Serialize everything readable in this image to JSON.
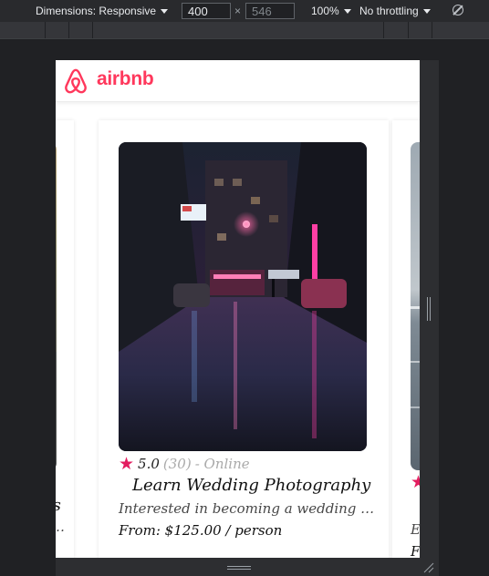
{
  "devtools": {
    "dimensions_label": "Dimensions: Responsive",
    "width_value": "400",
    "height_placeholder": "546",
    "times_sign": "×",
    "zoom": "100%",
    "throttling": "No throttling"
  },
  "brand": {
    "name": "airbnb",
    "color": "#ff385c"
  },
  "cards": [
    {
      "title_partial": "es",
      "desc_partial": "o…"
    },
    {
      "rating": "5.0",
      "reviews": "(30)",
      "mode": "- Online",
      "title": "Learn Wedding Photography",
      "description": "Interested in becoming a wedding …",
      "price": "From: $125.00 / person"
    },
    {
      "desc_partial": "E",
      "price_partial": "F"
    }
  ]
}
